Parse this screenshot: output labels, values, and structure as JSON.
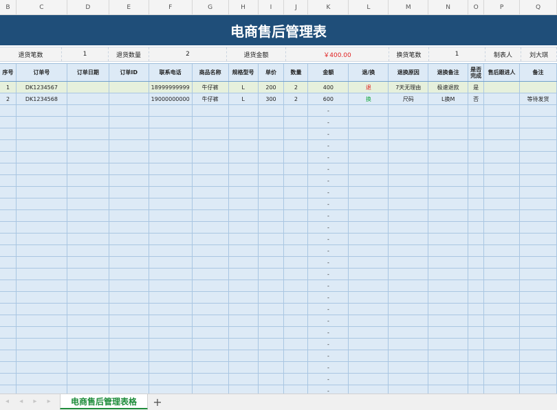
{
  "column_letters": [
    "B",
    "C",
    "D",
    "E",
    "F",
    "G",
    "H",
    "I",
    "J",
    "K",
    "L",
    "M",
    "N",
    "O",
    "P",
    "Q"
  ],
  "title": "电商售后管理表",
  "summary": [
    {
      "label": "退货笔数",
      "value": "1"
    },
    {
      "label": "退货数量",
      "value": "2"
    },
    {
      "label": "退货金额",
      "value": "￥400.00"
    },
    {
      "label": "换货笔数",
      "value": "1"
    },
    {
      "label": "制表人",
      "value": "刘大琪"
    }
  ],
  "headers": [
    "序号",
    "订单号",
    "订单日期",
    "订单ID",
    "联系电话",
    "商品名称",
    "规格型号",
    "单价",
    "数量",
    "金额",
    "退/换",
    "退换原因",
    "退换备注",
    "是否完成",
    "售后跟进人",
    "备注"
  ],
  "rows": [
    [
      "1",
      "DK1234567",
      "",
      "",
      "18999999999",
      "牛仔裤",
      "L",
      "200",
      "2",
      "400",
      "退",
      "7天无理由",
      "极速退款",
      "是",
      "",
      ""
    ],
    [
      "2",
      "DK1234568",
      "",
      "",
      "19000000000",
      "牛仔裤",
      "L",
      "300",
      "2",
      "600",
      "换",
      "尺码",
      "L换M",
      "否",
      "",
      "等待发货"
    ]
  ],
  "empty_amount_placeholder": "-",
  "sheet_tab": "电商售后管理表格",
  "add_sheet_icon": "+",
  "nav_arrows": "◂ ◂ ▸ ▸"
}
